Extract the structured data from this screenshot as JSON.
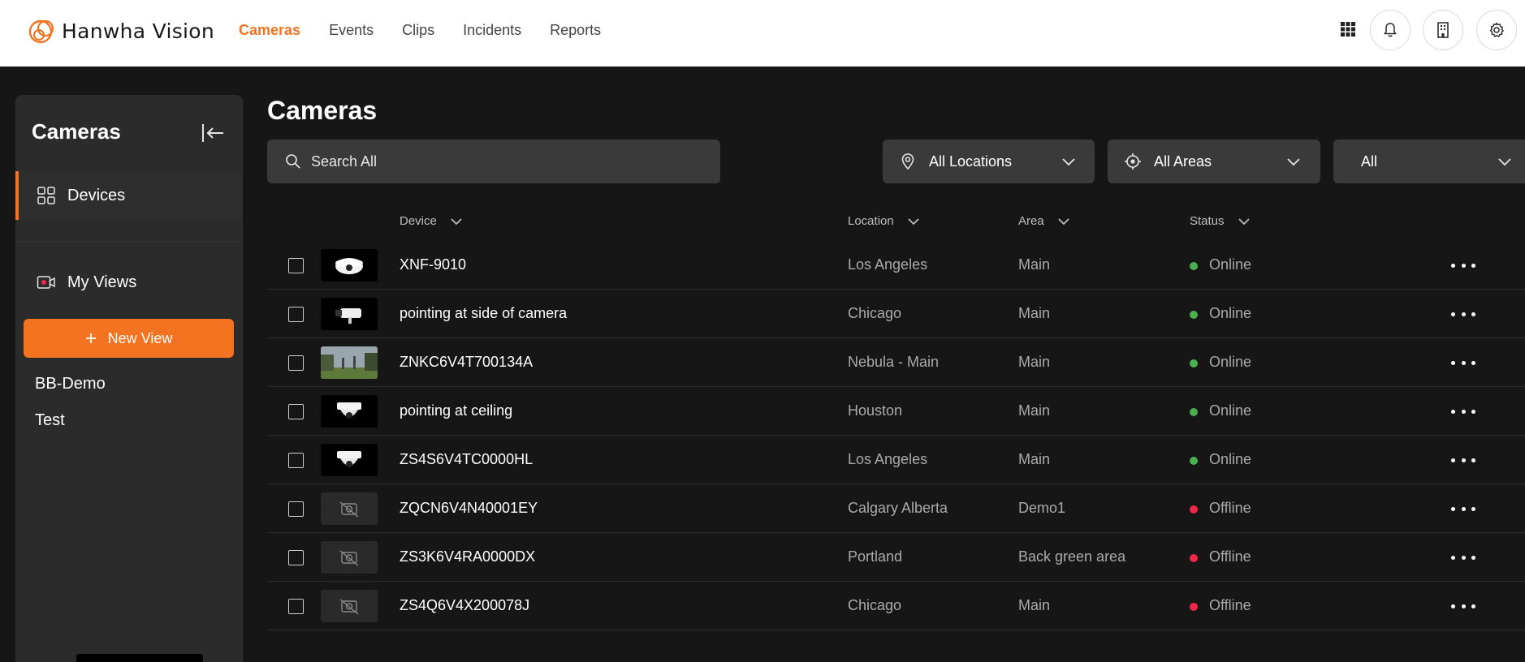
{
  "brand": {
    "name": "Hanwha Vision",
    "accent": "#f37321"
  },
  "nav": {
    "items": [
      {
        "label": "Cameras",
        "active": true
      },
      {
        "label": "Events",
        "active": false
      },
      {
        "label": "Clips",
        "active": false
      },
      {
        "label": "Incidents",
        "active": false
      },
      {
        "label": "Reports",
        "active": false
      }
    ],
    "icons": [
      "apps-grid-icon",
      "bell-icon",
      "building-icon",
      "gear-icon"
    ]
  },
  "sidebar": {
    "title": "Cameras",
    "items": [
      {
        "label": "Devices",
        "icon": "grid-icon",
        "active": true
      },
      {
        "label": "My Views",
        "icon": "video-icon",
        "active": false
      }
    ],
    "new_view_label": "New View",
    "views": [
      "BB-Demo",
      "Test"
    ]
  },
  "main": {
    "title": "Cameras",
    "search_placeholder": "Search All",
    "filters": {
      "locations": "All Locations",
      "areas": "All Areas",
      "status": "All"
    },
    "columns": {
      "device": "Device",
      "location": "Location",
      "area": "Area",
      "status": "Status"
    },
    "rows": [
      {
        "device": "XNF-9010",
        "location": "Los Angeles",
        "area": "Main",
        "status": "Online",
        "thumb": "fisheye"
      },
      {
        "device": "pointing at side of camera",
        "location": "Chicago",
        "area": "Main",
        "status": "Online",
        "thumb": "bullet"
      },
      {
        "device": "ZNKC6V4T700134A",
        "location": "Nebula - Main",
        "area": "Main",
        "status": "Online",
        "thumb": "scene"
      },
      {
        "device": "pointing at ceiling",
        "location": "Houston",
        "area": "Main",
        "status": "Online",
        "thumb": "dome"
      },
      {
        "device": "ZS4S6V4TC0000HL",
        "location": "Los Angeles",
        "area": "Main",
        "status": "Online",
        "thumb": "dome"
      },
      {
        "device": "ZQCN6V4N40001EY",
        "location": "Calgary Alberta",
        "area": "Demo1",
        "status": "Offline",
        "thumb": "none"
      },
      {
        "device": "ZS3K6V4RA0000DX",
        "location": "Portland",
        "area": "Back green area",
        "status": "Offline",
        "thumb": "none"
      },
      {
        "device": "ZS4Q6V4X200078J",
        "location": "Chicago",
        "area": "Main",
        "status": "Offline",
        "thumb": "none"
      }
    ],
    "status_colors": {
      "Online": "#4caf50",
      "Offline": "#f0264b"
    }
  }
}
